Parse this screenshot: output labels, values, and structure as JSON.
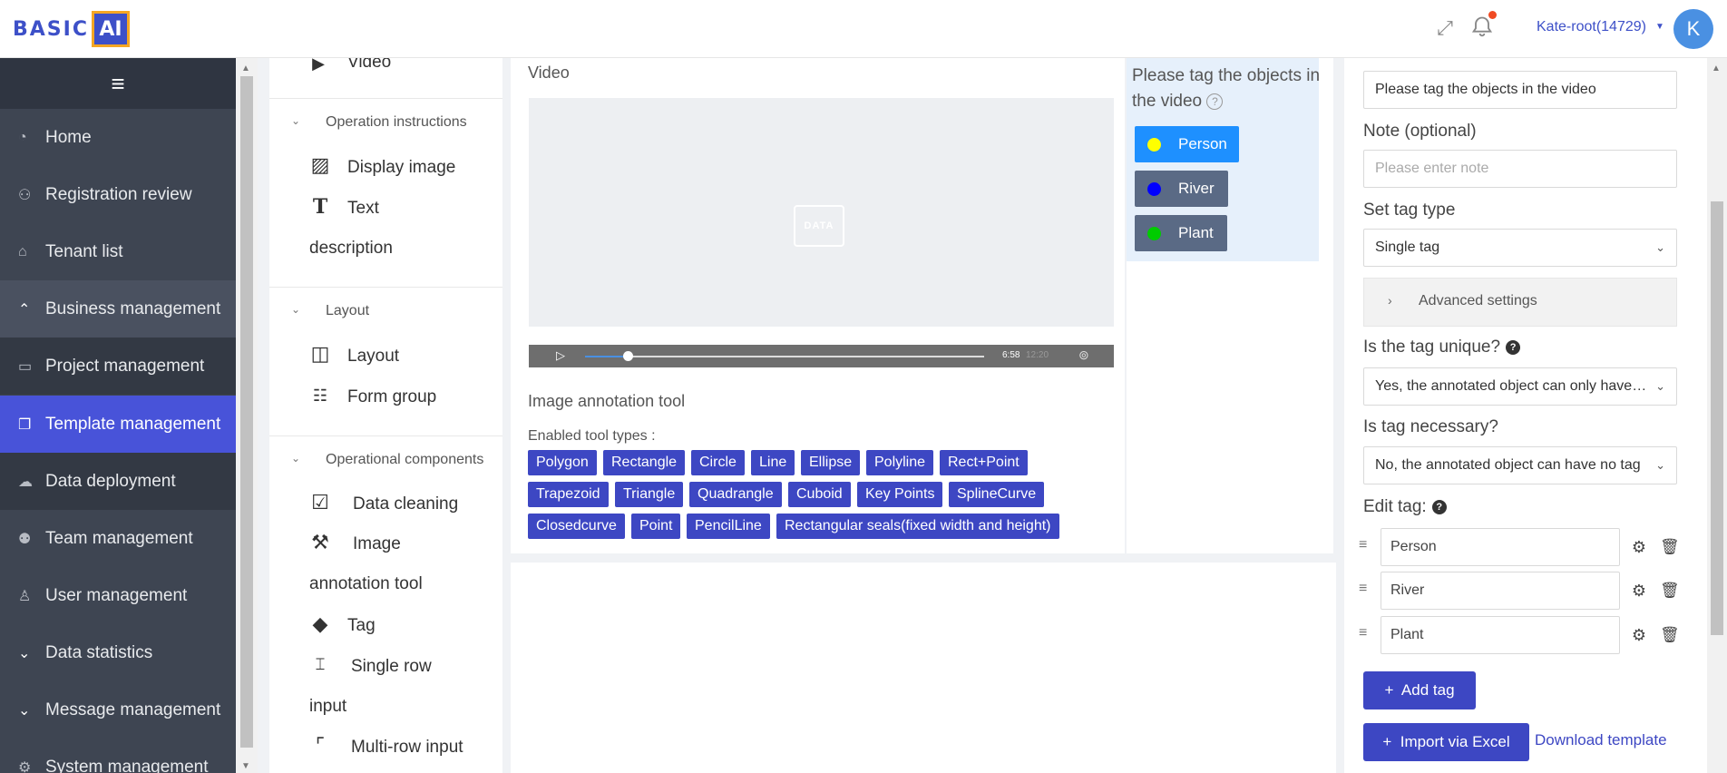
{
  "header": {
    "logo_text": "BASIC",
    "logo_box": "AI",
    "user": "Kate-root(14729)",
    "avatar_letter": "K"
  },
  "sidebar": {
    "items": [
      {
        "label": "Home",
        "icon": "dashboard-icon"
      },
      {
        "label": "Registration review",
        "icon": "user-add-icon"
      },
      {
        "label": "Tenant list",
        "icon": "building-icon"
      },
      {
        "label": "Business management",
        "icon": "chevron-up-icon"
      },
      {
        "label": "Project management",
        "icon": "briefcase-icon"
      },
      {
        "label": "Template management",
        "icon": "copy-icon"
      },
      {
        "label": "Data deployment",
        "icon": "cloud-icon"
      },
      {
        "label": "Team management",
        "icon": "team-icon"
      },
      {
        "label": "User management",
        "icon": "user-icon"
      },
      {
        "label": "Data statistics",
        "icon": "chevron-down-icon"
      },
      {
        "label": "Message management",
        "icon": "chevron-down-icon"
      },
      {
        "label": "System management",
        "icon": "gear-icon"
      }
    ]
  },
  "components": {
    "top_item": "Video",
    "sections": [
      {
        "title": "Operation instructions"
      },
      {
        "title": "Layout"
      },
      {
        "title": "Operational components"
      }
    ],
    "items": {
      "display_image": "Display image",
      "text_1": "Text",
      "text_2": "description",
      "layout": "Layout",
      "form_group": "Form group",
      "data_cleaning": "Data cleaning",
      "image_1": "Image",
      "image_2": "annotation tool",
      "tag": "Tag",
      "single_row_1": "Single row",
      "single_row_2": "input",
      "multi_row": "Multi-row input"
    }
  },
  "canvas": {
    "video_title": "Video",
    "video_folder_label": "DATA",
    "video_time": "6:58",
    "video_duration": "12:20",
    "iat_title": "Image annotation tool",
    "iat_label": "Enabled tool types :",
    "tools": [
      "Polygon",
      "Rectangle",
      "Circle",
      "Line",
      "Ellipse",
      "Polyline",
      "Rect+Point",
      "Trapezoid",
      "Triangle",
      "Quadrangle",
      "Cuboid",
      "Key Points",
      "SplineCurve",
      "Closedcurve",
      "Point",
      "PencilLine",
      "Rectangular seals(fixed width and height)"
    ],
    "tag_title": "Please tag the objects in the video",
    "tags": [
      {
        "label": "Person",
        "color": "#ffff00",
        "bg": "#1e90ff"
      },
      {
        "label": "River",
        "color": "#0000ff",
        "bg": "#5a6a85"
      },
      {
        "label": "Plant",
        "color": "#00cc00",
        "bg": "#5a6a85"
      }
    ]
  },
  "settings": {
    "title_value": "Please tag the objects in the video",
    "note_label": "Note (optional)",
    "note_placeholder": "Please enter note",
    "tag_type_label": "Set tag type",
    "tag_type_value": "Single tag",
    "advanced_label": "Advanced settings",
    "unique_label": "Is the tag unique?",
    "unique_value": "Yes, the annotated object can only have one tag",
    "necessary_label": "Is tag necessary?",
    "necessary_value": "No, the annotated object can have no tag",
    "edit_tag_label": "Edit tag:",
    "tag_rows": [
      "Person",
      "River",
      "Plant"
    ],
    "add_tag": "Add tag",
    "import_excel": "Import via Excel",
    "download_template": "Download template"
  }
}
